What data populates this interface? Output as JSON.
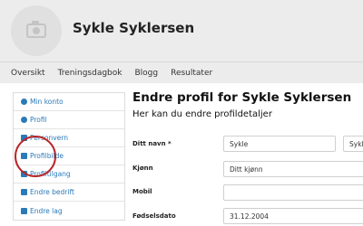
{
  "header": {
    "user_name": "Sykle Syklersen",
    "avatar_icon": "camera-icon"
  },
  "nav": {
    "items": [
      "Oversikt",
      "Treningsdagbok",
      "Blogg",
      "Resultater"
    ]
  },
  "sidebar": {
    "items": [
      {
        "label": "Min konto",
        "icon": "account-icon"
      },
      {
        "label": "Profil",
        "icon": "user-icon"
      },
      {
        "label": "Personvern",
        "icon": "privacy-icon"
      },
      {
        "label": "Profilbilde",
        "icon": "image-icon"
      },
      {
        "label": "Profiltilgang",
        "icon": "access-icon"
      },
      {
        "label": "Endre bedrift",
        "icon": "company-icon"
      },
      {
        "label": "Endre lag",
        "icon": "team-icon"
      }
    ]
  },
  "main": {
    "title": "Endre profil for Sykle Syklersen",
    "subtitle": "Her kan du endre profildetaljer",
    "form": {
      "name_label": "Ditt navn *",
      "first_name_value": "Sykle",
      "last_name_value": "Sykl",
      "gender_label": "Kjønn",
      "gender_value": "Ditt kjønn",
      "mobile_label": "Mobil",
      "mobile_value": "",
      "birthdate_label": "Fødselsdato",
      "birthdate_value": "31.12.2004"
    }
  },
  "colors": {
    "link": "#2a7ab8",
    "highlight": "#b8262a",
    "header_bg": "#ececec"
  }
}
